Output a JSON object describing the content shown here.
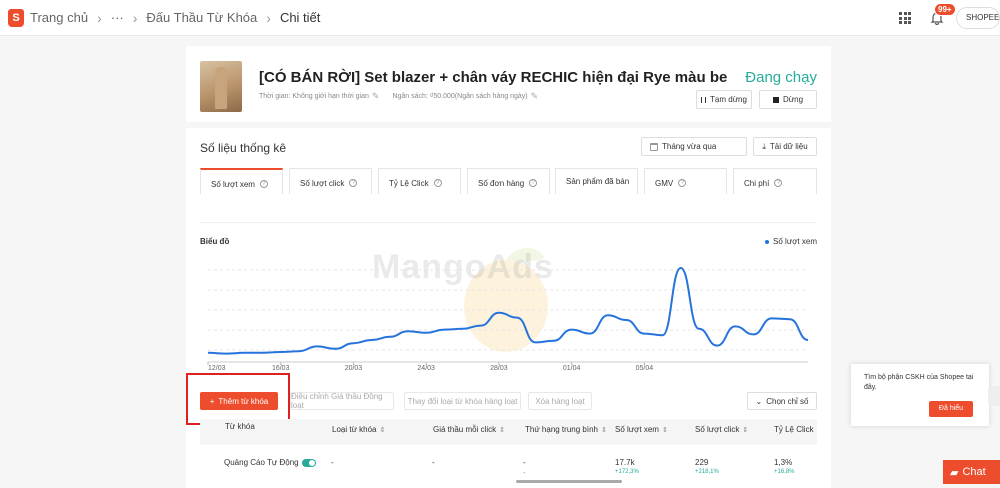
{
  "breadcrumb": {
    "logo_letter": "S",
    "home": "Trang chủ",
    "ellipsis": "···",
    "section": "Đấu Thầu Từ Khóa",
    "current": "Chi tiết"
  },
  "topbar": {
    "notification_count": "99+",
    "shop_label": "SHOPEE"
  },
  "product": {
    "title": "[CÓ BÁN RỜI] Set blazer + chân váy RECHIC hiện đại Rye màu be",
    "time_text": "Thời gian: Không giới hạn thời gian",
    "budget_text": "Ngân sách: ₫50.000(Ngân sách hàng ngày)",
    "status": "Đang chạy",
    "pause_label": "Tạm dừng",
    "stop_label": "Dừng"
  },
  "stats": {
    "title": "Số liệu thống kê",
    "period": "Tháng vừa qua",
    "download_label": "Tải dữ liệu",
    "metrics": [
      "Số lượt xem",
      "Số lượt click",
      "Tỷ Lệ Click",
      "Số đơn hàng",
      "Sản phẩm đã bán",
      "GMV",
      "Chi phí"
    ],
    "chart_label": "Biểu đồ",
    "legend": "Số lượt xem"
  },
  "chart_data": {
    "type": "line",
    "title": "Biểu đồ",
    "xlabel": "",
    "ylabel": "",
    "x_ticks": [
      "12/03",
      "16/03",
      "20/03",
      "24/03",
      "28/03",
      "01/04",
      "05/04"
    ],
    "grid": true,
    "series": [
      {
        "name": "Số lượt xem",
        "color": "#2673dd",
        "values": [
          4,
          3,
          4,
          4,
          5,
          6,
          12,
          9,
          16,
          20,
          24,
          31,
          29,
          33,
          34,
          38,
          54,
          48,
          17,
          19,
          33,
          28,
          51,
          45,
          28,
          26,
          110,
          34,
          13,
          37,
          27,
          47,
          46,
          20
        ]
      }
    ]
  },
  "watermark": "MangoAds",
  "actions": {
    "add_keyword": "Thêm từ khóa",
    "adjust_bid": "Điều chỉnh Giá thầu Đồng loạt",
    "change_match": "Thay đổi loại từ khóa hàng loạt",
    "bulk_delete": "Xóa hàng loạt",
    "choose_metrics": "Chọn chỉ số"
  },
  "table": {
    "headers": [
      "Từ khóa",
      "Loại từ khóa",
      "Giá thầu mỗi click",
      "Thứ hạng trung bình",
      "Số lượt xem",
      "Số lượt click",
      "Tỷ Lệ Click"
    ],
    "row": {
      "keyword": "Quảng Cáo Tự Động",
      "match_type": "-",
      "bid": "-",
      "rank": "-",
      "rank_sub": "-",
      "views": "17.7k",
      "views_change": "+172,3%",
      "clicks": "229",
      "clicks_change": "+218,1%",
      "ctr": "1,3%",
      "ctr_change": "+16,8%"
    }
  },
  "chat_popup": {
    "message": "Tìm bộ phận CSKH của Shopee tại đây.",
    "ok_label": "Đã hiểu"
  },
  "chat_button": "Chat"
}
